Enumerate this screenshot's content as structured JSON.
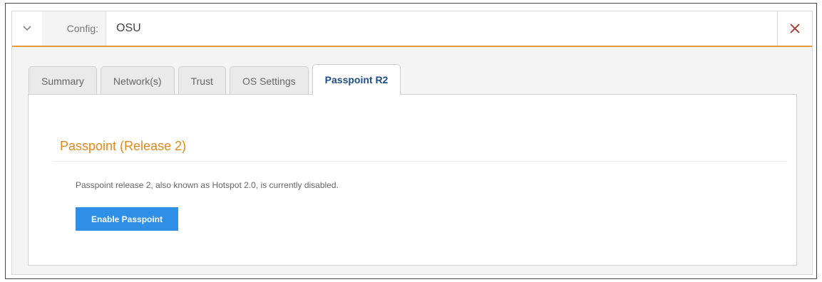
{
  "header": {
    "label": "Config:",
    "value": "OSU",
    "toggle_icon": "chevron-down-icon",
    "close_icon": "close-icon",
    "close_glyph": "✕"
  },
  "tabs": [
    {
      "label": "Summary",
      "active": false
    },
    {
      "label": "Network(s)",
      "active": false
    },
    {
      "label": "Trust",
      "active": false
    },
    {
      "label": "OS Settings",
      "active": false
    },
    {
      "label": "Passpoint R2",
      "active": true
    }
  ],
  "content": {
    "title": "Passpoint (Release 2)",
    "description": "Passpoint release 2, also known as Hotspot 2.0, is currently disabled.",
    "enable_button": "Enable Passpoint"
  },
  "colors": {
    "accent": "#e69a3c",
    "title": "#e0891e",
    "button": "#2f8ee6",
    "close": "#a0342a",
    "active_tab_text": "#1b4f8a"
  }
}
